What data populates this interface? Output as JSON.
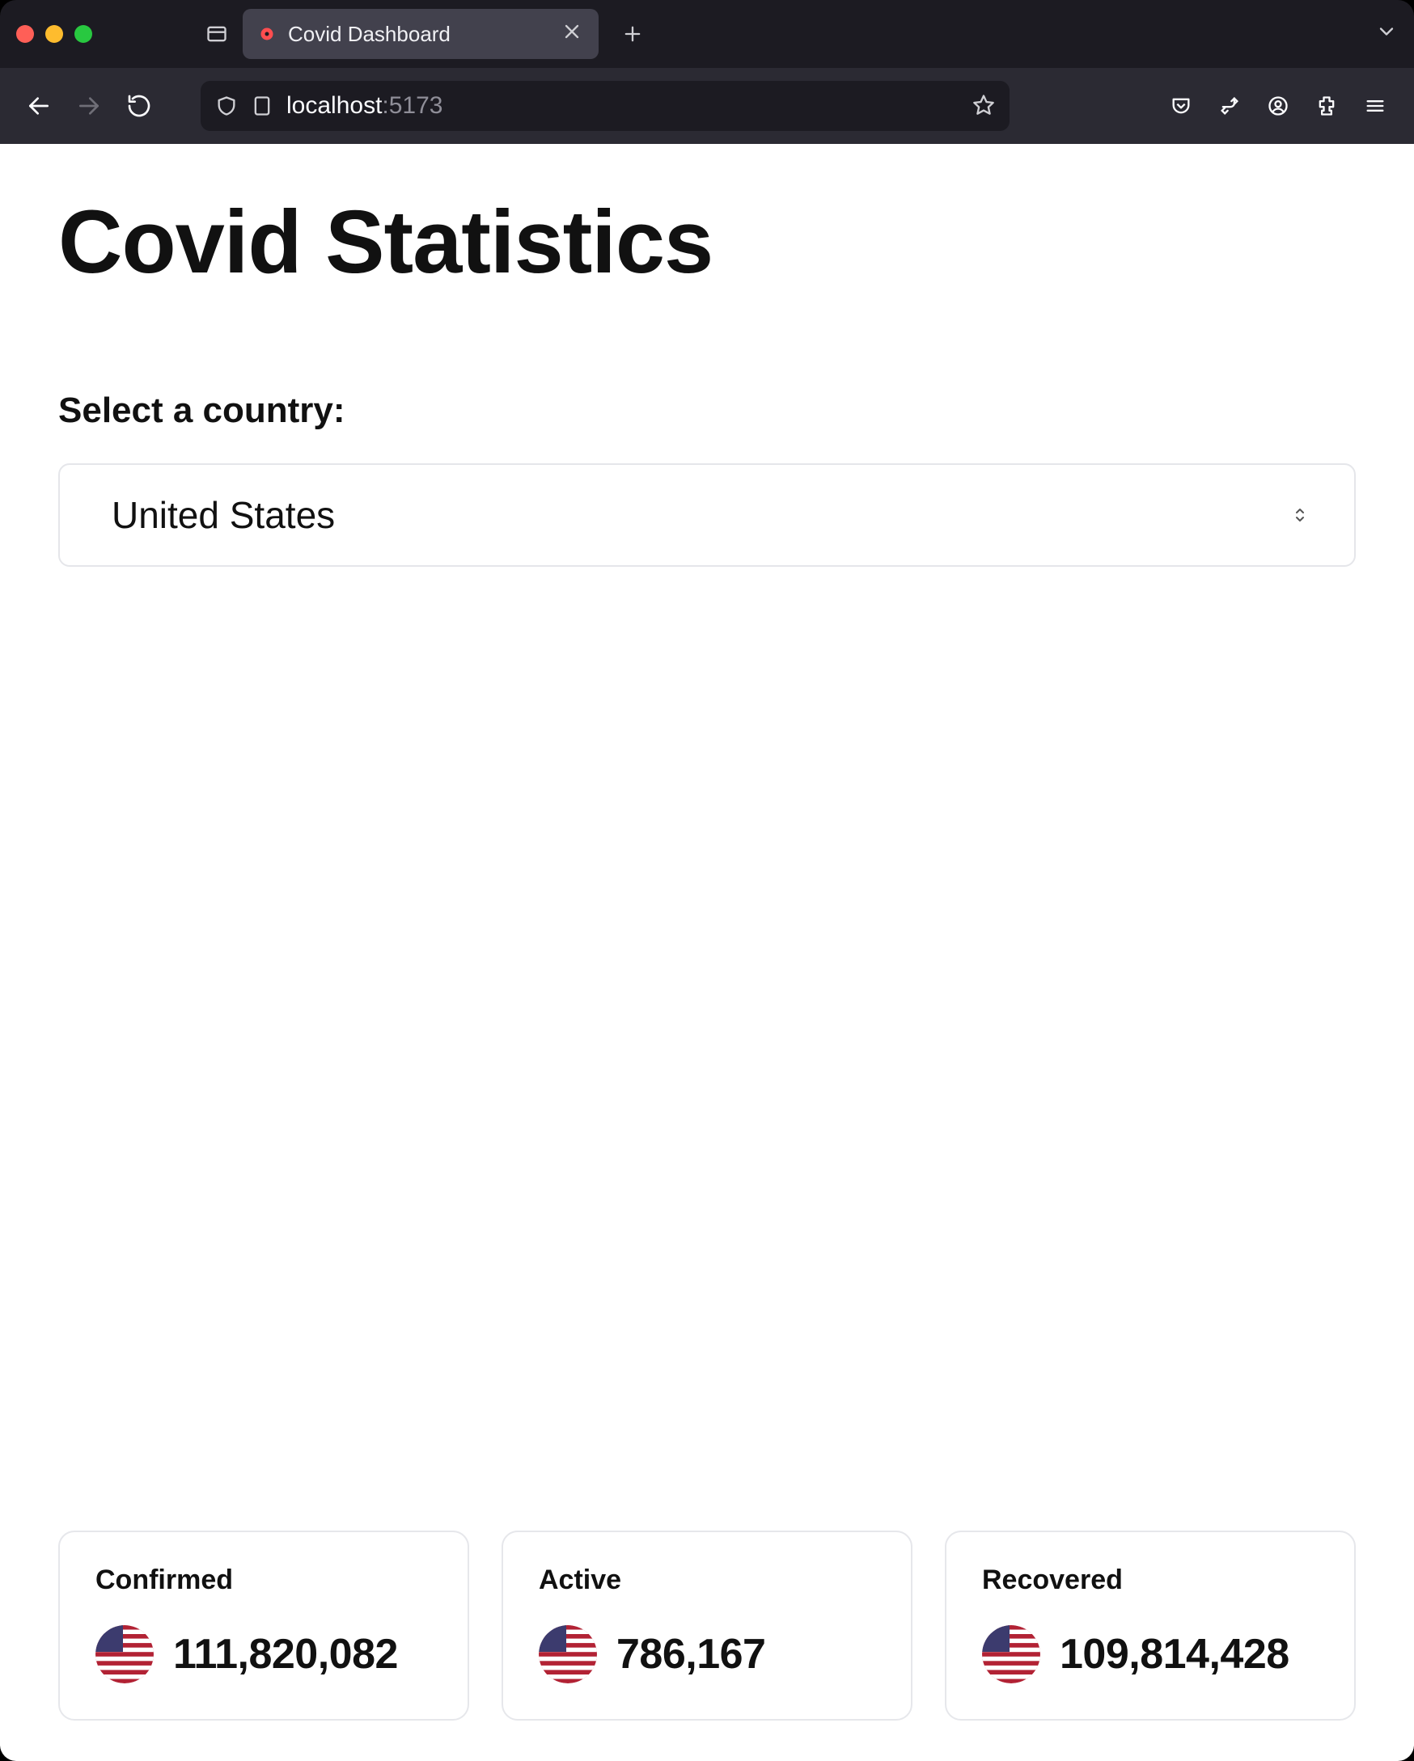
{
  "browser": {
    "tab_title": "Covid Dashboard",
    "url_host": "localhost",
    "url_port": ":5173"
  },
  "page": {
    "title": "Covid Statistics",
    "select_label": "Select a country:",
    "selected_country": "United States",
    "cards": [
      {
        "label": "Confirmed",
        "value": "111,820,082"
      },
      {
        "label": "Active",
        "value": "786,167"
      },
      {
        "label": "Recovered",
        "value": "109,814,428"
      }
    ]
  }
}
